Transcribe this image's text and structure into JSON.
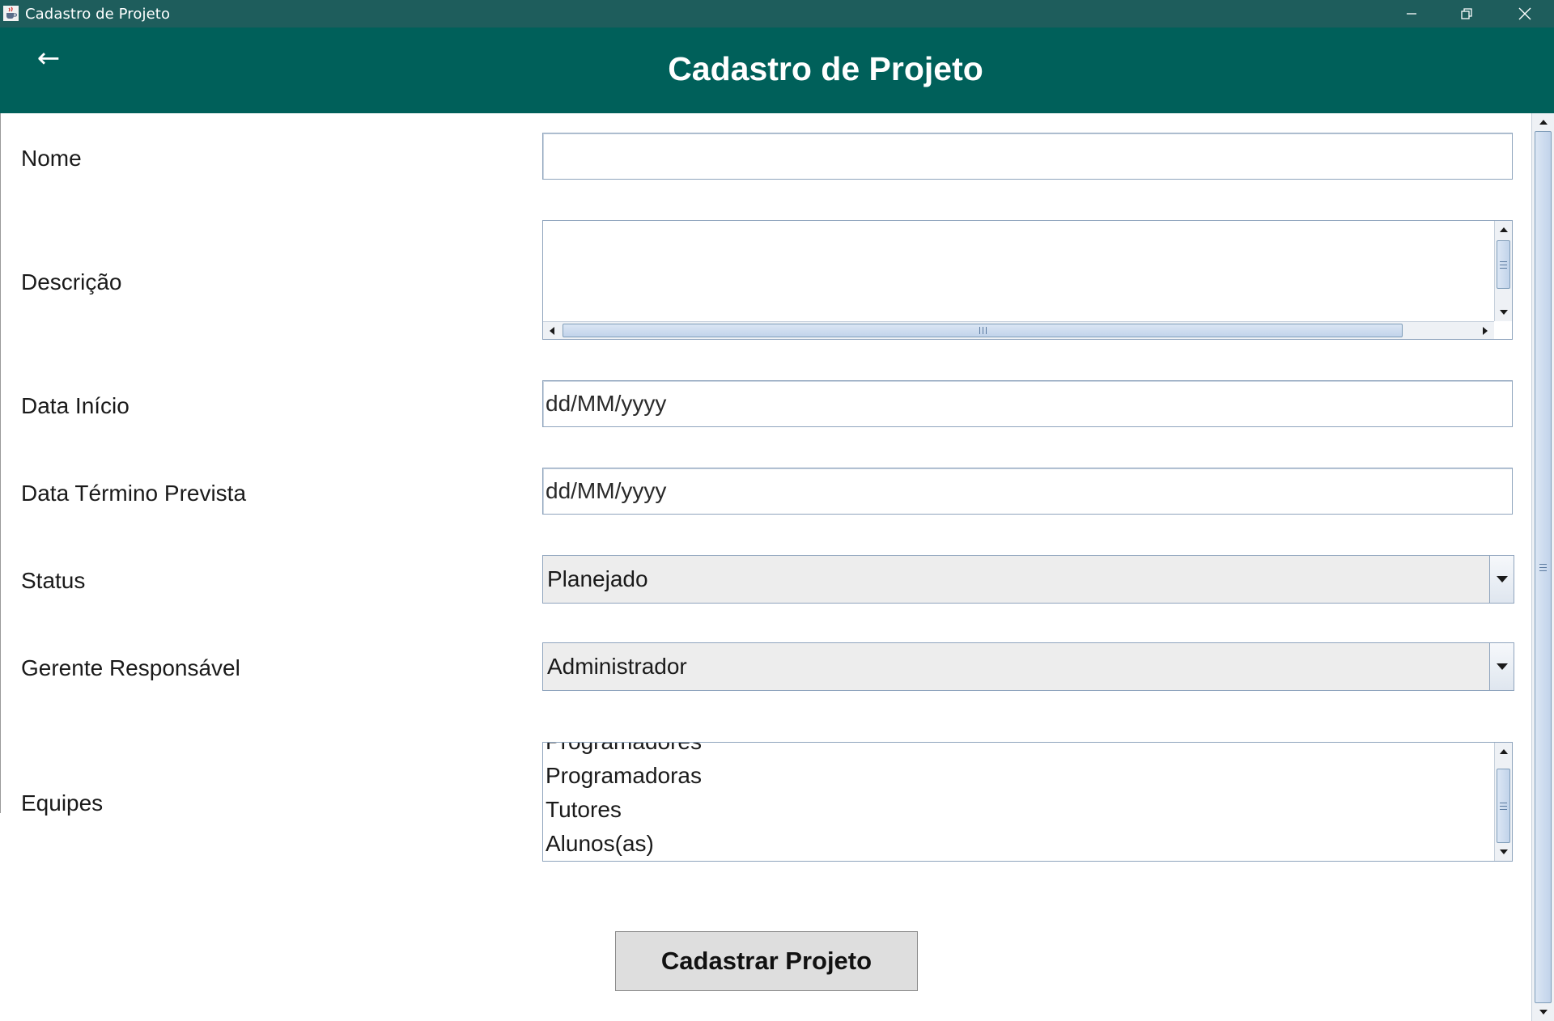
{
  "window": {
    "title": "Cadastro de Projeto",
    "app_icon": "java-cup-icon"
  },
  "header": {
    "back_glyph": "←",
    "title": "Cadastro de Projeto",
    "background": "#00605a"
  },
  "form": {
    "nome": {
      "label": "Nome",
      "value": ""
    },
    "descricao": {
      "label": "Descrição",
      "value": ""
    },
    "data_inicio": {
      "label": "Data Início",
      "value": "dd/MM/yyyy"
    },
    "data_termino": {
      "label": "Data Término Prevista",
      "value": "dd/MM/yyyy"
    },
    "status": {
      "label": "Status",
      "selected": "Planejado"
    },
    "gerente": {
      "label": "Gerente Responsável",
      "selected": "Administrador"
    },
    "equipes": {
      "label": "Equipes",
      "items": [
        "Programadores",
        "Programadoras",
        "Tutores",
        "Alunos(as)"
      ]
    },
    "submit_label": "Cadastrar Projeto"
  },
  "colors": {
    "titlebar": "#1e5d5c",
    "header": "#00605a",
    "field_border": "#8fa4bd",
    "button_bg": "#dedede"
  }
}
